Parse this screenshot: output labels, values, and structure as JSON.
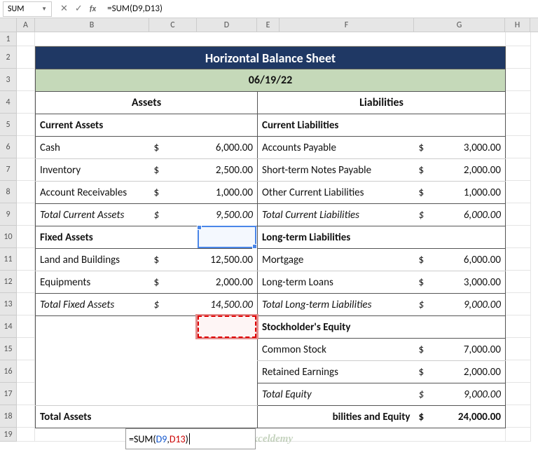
{
  "nameBox": "SUM",
  "formulaBarIcons": {
    "cancel": "✕",
    "confirm": "✓",
    "fx": "fx"
  },
  "formula": "=SUM(D9,D13)",
  "columns": [
    "A",
    "B",
    "C",
    "D",
    "E",
    "F",
    "G",
    "H"
  ],
  "rows": [
    "1",
    "2",
    "3",
    "4",
    "5",
    "6",
    "7",
    "8",
    "9",
    "10",
    "11",
    "12",
    "13",
    "14",
    "15",
    "16",
    "17",
    "18",
    "19"
  ],
  "title": "Horizontal Balance Sheet",
  "date": "06/19/22",
  "assetsHeader": "Assets",
  "liabHeader": "Liabilities",
  "left": {
    "section1": "Current Assets",
    "r1": {
      "label": "Cash",
      "cur": "$",
      "val": "6,000.00"
    },
    "r2": {
      "label": "Inventory",
      "cur": "$",
      "val": "2,500.00"
    },
    "r3": {
      "label": "Account Receivables",
      "cur": "$",
      "val": "1,000.00"
    },
    "tot1": {
      "label": "Total Current Assets",
      "cur": "$",
      "val": "9,500.00"
    },
    "section2": "Fixed Assets",
    "r4": {
      "label": "Land and Buildings",
      "cur": "$",
      "val": "12,500.00"
    },
    "r5": {
      "label": "Equipments",
      "cur": "$",
      "val": "2,000.00"
    },
    "tot2": {
      "label": "Total Fixed Assets",
      "cur": "$",
      "val": "14,500.00"
    },
    "grand": {
      "label": "Total Assets"
    }
  },
  "right": {
    "section1": "Current Liabilities",
    "r1": {
      "label": "Accounts Payable",
      "cur": "$",
      "val": "3,000.00"
    },
    "r2": {
      "label": "Short-term Notes Payable",
      "cur": "$",
      "val": "2,000.00"
    },
    "r3": {
      "label": "Other Current Liabilities",
      "cur": "$",
      "val": "1,000.00"
    },
    "tot1": {
      "label": "Total Current Liabilities",
      "cur": "$",
      "val": "6,000.00"
    },
    "section2": "Long-term Liabilities",
    "r4": {
      "label": "Mortgage",
      "cur": "$",
      "val": "6,000.00"
    },
    "r5": {
      "label": "Long-term Loans",
      "cur": "$",
      "val": "3,000.00"
    },
    "tot2": {
      "label": "Total Long-term Liabilities",
      "cur": "$",
      "val": "9,000.00"
    },
    "section3": "Stockholder's Equity",
    "r6": {
      "label": "Common Stock",
      "cur": "$",
      "val": "7,000.00"
    },
    "r7": {
      "label": "Retained Earnings",
      "cur": "$",
      "val": "2,000.00"
    },
    "tot3": {
      "label": "Total Equity",
      "cur": "$",
      "val": "9,000.00"
    },
    "grand": {
      "label": "bilities and Equity",
      "cur": "$",
      "val": "24,000.00"
    }
  },
  "inlineEdit": {
    "prefix": "=SUM(",
    "ref1": "D9",
    "comma": ",",
    "ref2": "D13",
    "suffix": ")"
  },
  "watermark": "exceldemy"
}
